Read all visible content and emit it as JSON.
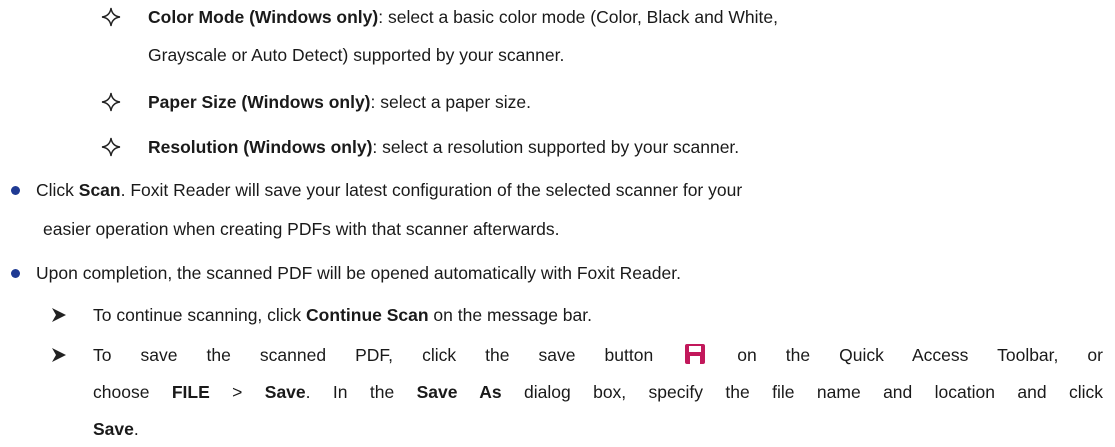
{
  "sub_items": [
    {
      "term": "Color Mode (Windows only)",
      "text_line1": ": select a basic color mode (Color, Black and White,",
      "text_line2": "Grayscale or Auto Detect) supported by your scanner."
    },
    {
      "term": "Paper Size (Windows only)",
      "text": ": select a paper size."
    },
    {
      "term": "Resolution (Windows only)",
      "text": ": select a resolution supported by your scanner."
    }
  ],
  "bullets": [
    {
      "prefix": "Click ",
      "bold": "Scan",
      "suffix_line1": ". Foxit Reader will save your latest configuration of the selected scanner for your",
      "line2": "easier operation when creating PDFs with that scanner afterwards."
    },
    {
      "text": "Upon completion, the scanned PDF will be opened automatically with Foxit Reader."
    }
  ],
  "arrow_items": [
    {
      "prefix": "To continue scanning, click ",
      "bold": "Continue Scan",
      "suffix": " on the message bar."
    },
    {
      "line1_prefix": "To save the scanned PDF, click the save button",
      "line1_suffix": "on the Quick Access Toolbar, or",
      "line2_p1": "choose ",
      "line2_b1": "FILE",
      "line2_p2": " > ",
      "line2_b2": "Save",
      "line2_p3": ". In the ",
      "line2_b3": "Save As",
      "line2_p4": " dialog box, specify the file name and location and click",
      "line3_bold": "Save",
      "line3_suffix": "."
    }
  ],
  "colors": {
    "bullet": "#1f3a93",
    "save_icon": "#c2185b",
    "text": "#1a1a1a"
  }
}
